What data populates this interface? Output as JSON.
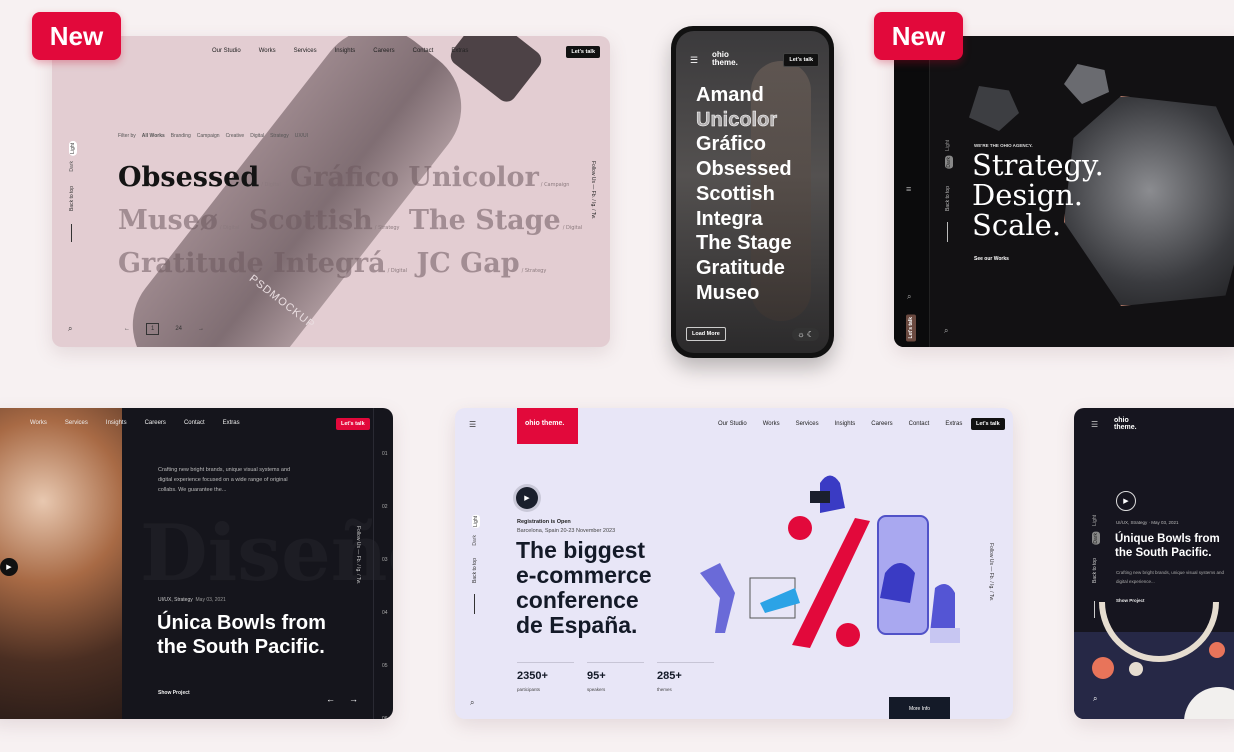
{
  "badges": {
    "new": "New"
  },
  "colors": {
    "accent": "#e2093b",
    "card1_bg": "#e3cdd2",
    "dark": "#14141b",
    "lavender": "#e8e6f7"
  },
  "card1": {
    "nav": [
      "Our Studio",
      "Works",
      "Services",
      "Insights",
      "Careers",
      "Contact",
      "Extras"
    ],
    "cta": "Let's talk",
    "filter_label": "Filter by",
    "filters": [
      "All Works",
      "Branding",
      "Campaign",
      "Creative",
      "Digital",
      "Strategy",
      "UX/UI"
    ],
    "rows": [
      [
        {
          "t": "Obsessed",
          "tag": "/ Digital"
        },
        {
          "t": "Gráfico",
          "tag": ""
        },
        {
          "t": "Unicolor",
          "tag": "/ Campaign"
        }
      ],
      [
        {
          "t": "Museø",
          "tag": "/ Digital"
        },
        {
          "t": "Scottish",
          "tag": "/ Strategy"
        },
        {
          "t": "The Stage",
          "tag": "/ Digital"
        }
      ],
      [
        {
          "t": "Gratitude",
          "tag": ""
        },
        {
          "t": "Integrá",
          "tag": "/ Digital"
        },
        {
          "t": "JC Gap",
          "tag": "/ Strategy"
        }
      ]
    ],
    "mockup_text": "PSDMOCKUP",
    "back_to_top": "Back to top",
    "dark": "Dark",
    "light": "Light",
    "follow": "Follow Us — Fb. / Ig. / Tw.",
    "pager": {
      "prev": "←",
      "current": "1",
      "next": "→",
      "total": "24"
    }
  },
  "phone": {
    "logo": "ohio theme.",
    "cta": "Let's talk",
    "items": [
      "Amand",
      "Unicolor",
      "Gráfico",
      "Obsessed",
      "Scottish",
      "Integra",
      "The Stage",
      "Gratitude",
      "Museo"
    ],
    "load_more": "Load More"
  },
  "card3": {
    "eyebrow": "WE'RE THE OHIO AGENCY.",
    "lines": [
      "Strategy.",
      "Design.",
      "Scale."
    ],
    "link": "See our Works",
    "cta": "Let's talk",
    "back_to_top": "Back to top",
    "dark": "Dark",
    "light": "Light"
  },
  "card4": {
    "nav": [
      "Works",
      "Services",
      "Insights",
      "Careers",
      "Contact",
      "Extras"
    ],
    "cta": "Let's talk",
    "desc": "Crafting new bright brands, unique visual systems and digital experience focused on a wide range of original collabs. We guarantee the...",
    "bg_text": "Diseño",
    "meta": "UI/UX, Strategy",
    "date": "May 03, 2021",
    "title": "Única Bowls from the South Pacific.",
    "link": "Show Project",
    "numbers": [
      "01",
      "02",
      "03",
      "04",
      "05",
      "06"
    ],
    "follow": "Follow Us — Fb. / Ig. / Tw."
  },
  "card5": {
    "logo": "ohio theme.",
    "nav": [
      "Our Studio",
      "Works",
      "Services",
      "Insights",
      "Careers",
      "Contact",
      "Extras"
    ],
    "cta": "Let's talk",
    "reg": "Registration is Open",
    "place": "Barcelona, Spain 20-23 November 2023",
    "title": [
      "The biggest",
      "e-commerce",
      "conference",
      "de España."
    ],
    "stats": [
      {
        "v": "2350+",
        "l": "participants"
      },
      {
        "v": "95+",
        "l": "speakers"
      },
      {
        "v": "285+",
        "l": "themes"
      }
    ],
    "more": "More Info",
    "back_to_top": "Back to top",
    "dark": "Dark",
    "light": "Light",
    "follow": "Follow Us — Fb. / Ig. / Tw."
  },
  "card6": {
    "logo": "ohio theme.",
    "meta": "UI/UX, Strategy",
    "date": "May 03, 2021",
    "title": "Únique Bowls from the South Pacific.",
    "desc": "Crafting new bright brands, unique visual systems and digital experience...",
    "link": "Show Project",
    "back_to_top": "Back to top",
    "dark": "Dark",
    "light": "Light"
  }
}
